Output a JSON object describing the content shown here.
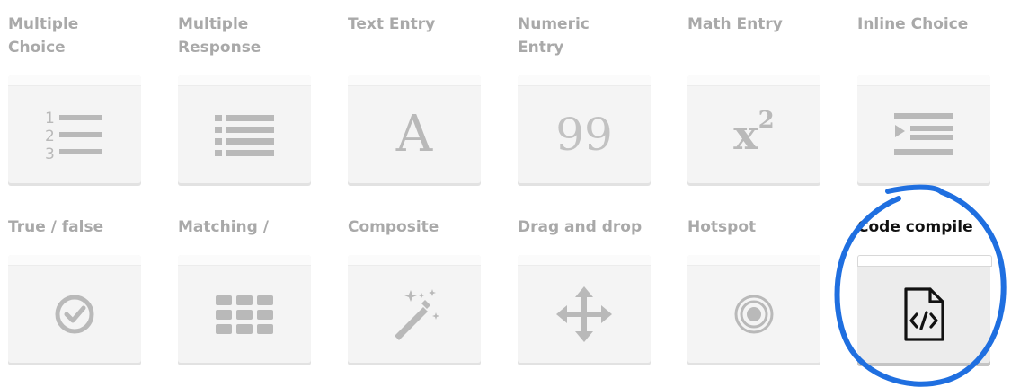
{
  "question_types": [
    {
      "label": "Multiple\nChoice",
      "icon": "ordered-list-icon"
    },
    {
      "label": "Multiple\nResponse",
      "icon": "bulleted-list-icon"
    },
    {
      "label": "Text Entry",
      "icon": "letter-a-icon",
      "glyph": "A"
    },
    {
      "label": "Numeric\nEntry",
      "icon": "number-99-icon",
      "glyph": "99"
    },
    {
      "label": "Math Entry",
      "icon": "x-squared-icon",
      "glyph": "x",
      "superscript": "2"
    },
    {
      "label": "Inline Choice",
      "icon": "indent-list-icon"
    },
    {
      "label": "True / false",
      "icon": "check-circle-icon"
    },
    {
      "label": "Matching /",
      "icon": "grid-icon"
    },
    {
      "label": "Composite",
      "icon": "magic-wand-icon"
    },
    {
      "label": "Drag and drop",
      "icon": "move-arrows-icon"
    },
    {
      "label": "Hotspot",
      "icon": "target-icon"
    },
    {
      "label": "Code compile",
      "icon": "code-file-icon",
      "selected": true
    }
  ],
  "colors": {
    "label": "#a9a9a9",
    "label_selected": "#111111",
    "icon": "#b9b9b9",
    "card": "#f4f4f4",
    "annotation": "#1f6fe0"
  }
}
